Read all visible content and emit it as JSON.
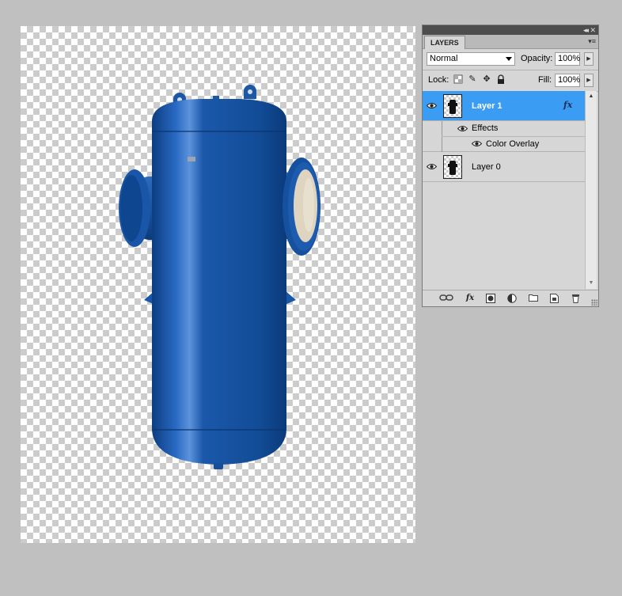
{
  "panel": {
    "tab_label": "LAYERS",
    "collapse_icon": "double-chevron-left-icon",
    "close_icon": "close-icon",
    "menu_icon": "panel-menu-icon"
  },
  "controls": {
    "blend_mode": "Normal",
    "opacity_label": "Opacity:",
    "opacity_value": "100%",
    "lock_label": "Lock:",
    "fill_label": "Fill:",
    "fill_value": "100%"
  },
  "layers": [
    {
      "name": "Layer 1",
      "selected": true,
      "visible": true,
      "has_fx": true,
      "fx_label": "fx",
      "effects_label": "Effects",
      "effects": [
        {
          "name": "Color Overlay",
          "visible": true
        }
      ]
    },
    {
      "name": "Layer 0",
      "selected": false,
      "visible": true,
      "has_fx": false
    }
  ],
  "bottom_icons": [
    "link-layers-icon",
    "fx-icon",
    "add-mask-icon",
    "adjustment-layer-icon",
    "new-group-icon",
    "new-layer-icon",
    "trash-icon"
  ],
  "colors": {
    "selection": "#3b9cf4",
    "object_blue": "#124c96",
    "flange_face": "#ded4c0",
    "workspace": "#c0c0c0"
  }
}
